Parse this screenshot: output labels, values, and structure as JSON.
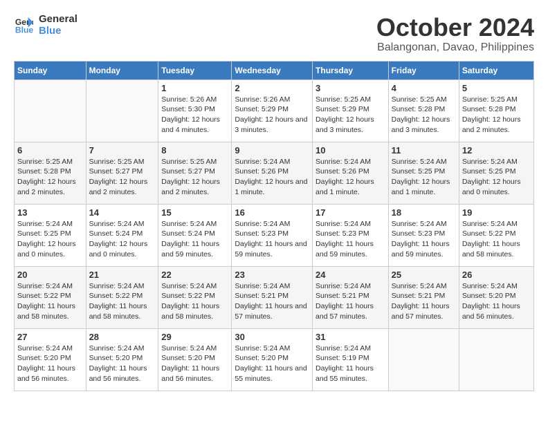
{
  "header": {
    "logo_line1": "General",
    "logo_line2": "Blue",
    "month": "October 2024",
    "location": "Balangonan, Davao, Philippines"
  },
  "weekdays": [
    "Sunday",
    "Monday",
    "Tuesday",
    "Wednesday",
    "Thursday",
    "Friday",
    "Saturday"
  ],
  "weeks": [
    [
      {
        "day": "",
        "info": ""
      },
      {
        "day": "",
        "info": ""
      },
      {
        "day": "1",
        "info": "Sunrise: 5:26 AM\nSunset: 5:30 PM\nDaylight: 12 hours and 4 minutes."
      },
      {
        "day": "2",
        "info": "Sunrise: 5:26 AM\nSunset: 5:29 PM\nDaylight: 12 hours and 3 minutes."
      },
      {
        "day": "3",
        "info": "Sunrise: 5:25 AM\nSunset: 5:29 PM\nDaylight: 12 hours and 3 minutes."
      },
      {
        "day": "4",
        "info": "Sunrise: 5:25 AM\nSunset: 5:28 PM\nDaylight: 12 hours and 3 minutes."
      },
      {
        "day": "5",
        "info": "Sunrise: 5:25 AM\nSunset: 5:28 PM\nDaylight: 12 hours and 2 minutes."
      }
    ],
    [
      {
        "day": "6",
        "info": "Sunrise: 5:25 AM\nSunset: 5:28 PM\nDaylight: 12 hours and 2 minutes."
      },
      {
        "day": "7",
        "info": "Sunrise: 5:25 AM\nSunset: 5:27 PM\nDaylight: 12 hours and 2 minutes."
      },
      {
        "day": "8",
        "info": "Sunrise: 5:25 AM\nSunset: 5:27 PM\nDaylight: 12 hours and 2 minutes."
      },
      {
        "day": "9",
        "info": "Sunrise: 5:24 AM\nSunset: 5:26 PM\nDaylight: 12 hours and 1 minute."
      },
      {
        "day": "10",
        "info": "Sunrise: 5:24 AM\nSunset: 5:26 PM\nDaylight: 12 hours and 1 minute."
      },
      {
        "day": "11",
        "info": "Sunrise: 5:24 AM\nSunset: 5:25 PM\nDaylight: 12 hours and 1 minute."
      },
      {
        "day": "12",
        "info": "Sunrise: 5:24 AM\nSunset: 5:25 PM\nDaylight: 12 hours and 0 minutes."
      }
    ],
    [
      {
        "day": "13",
        "info": "Sunrise: 5:24 AM\nSunset: 5:25 PM\nDaylight: 12 hours and 0 minutes."
      },
      {
        "day": "14",
        "info": "Sunrise: 5:24 AM\nSunset: 5:24 PM\nDaylight: 12 hours and 0 minutes."
      },
      {
        "day": "15",
        "info": "Sunrise: 5:24 AM\nSunset: 5:24 PM\nDaylight: 11 hours and 59 minutes."
      },
      {
        "day": "16",
        "info": "Sunrise: 5:24 AM\nSunset: 5:23 PM\nDaylight: 11 hours and 59 minutes."
      },
      {
        "day": "17",
        "info": "Sunrise: 5:24 AM\nSunset: 5:23 PM\nDaylight: 11 hours and 59 minutes."
      },
      {
        "day": "18",
        "info": "Sunrise: 5:24 AM\nSunset: 5:23 PM\nDaylight: 11 hours and 59 minutes."
      },
      {
        "day": "19",
        "info": "Sunrise: 5:24 AM\nSunset: 5:22 PM\nDaylight: 11 hours and 58 minutes."
      }
    ],
    [
      {
        "day": "20",
        "info": "Sunrise: 5:24 AM\nSunset: 5:22 PM\nDaylight: 11 hours and 58 minutes."
      },
      {
        "day": "21",
        "info": "Sunrise: 5:24 AM\nSunset: 5:22 PM\nDaylight: 11 hours and 58 minutes."
      },
      {
        "day": "22",
        "info": "Sunrise: 5:24 AM\nSunset: 5:22 PM\nDaylight: 11 hours and 58 minutes."
      },
      {
        "day": "23",
        "info": "Sunrise: 5:24 AM\nSunset: 5:21 PM\nDaylight: 11 hours and 57 minutes."
      },
      {
        "day": "24",
        "info": "Sunrise: 5:24 AM\nSunset: 5:21 PM\nDaylight: 11 hours and 57 minutes."
      },
      {
        "day": "25",
        "info": "Sunrise: 5:24 AM\nSunset: 5:21 PM\nDaylight: 11 hours and 57 minutes."
      },
      {
        "day": "26",
        "info": "Sunrise: 5:24 AM\nSunset: 5:20 PM\nDaylight: 11 hours and 56 minutes."
      }
    ],
    [
      {
        "day": "27",
        "info": "Sunrise: 5:24 AM\nSunset: 5:20 PM\nDaylight: 11 hours and 56 minutes."
      },
      {
        "day": "28",
        "info": "Sunrise: 5:24 AM\nSunset: 5:20 PM\nDaylight: 11 hours and 56 minutes."
      },
      {
        "day": "29",
        "info": "Sunrise: 5:24 AM\nSunset: 5:20 PM\nDaylight: 11 hours and 56 minutes."
      },
      {
        "day": "30",
        "info": "Sunrise: 5:24 AM\nSunset: 5:20 PM\nDaylight: 11 hours and 55 minutes."
      },
      {
        "day": "31",
        "info": "Sunrise: 5:24 AM\nSunset: 5:19 PM\nDaylight: 11 hours and 55 minutes."
      },
      {
        "day": "",
        "info": ""
      },
      {
        "day": "",
        "info": ""
      }
    ]
  ]
}
